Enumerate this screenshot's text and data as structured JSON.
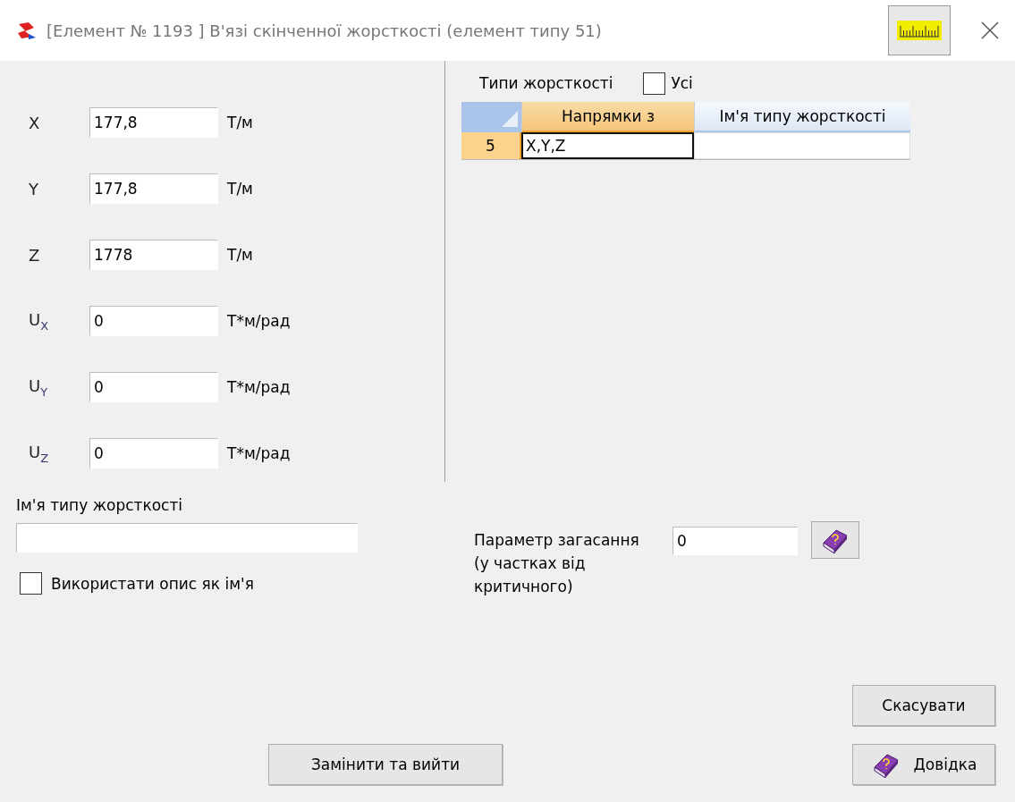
{
  "window": {
    "title": "[Елемент № 1193 ] В'язі скінченної жорсткості (елемент типу 51)"
  },
  "stiffness": [
    {
      "label": "X",
      "value": "177,8",
      "unit": "Т/м"
    },
    {
      "label": "Y",
      "value": "177,8",
      "unit": "Т/м"
    },
    {
      "label": "Z",
      "value": "1778",
      "unit": "Т/м"
    },
    {
      "label": "U$_{X}$",
      "value": "0",
      "unit": "Т*м/рад"
    },
    {
      "label": "U$_{Y}$",
      "value": "0",
      "unit": "Т*м/рад"
    },
    {
      "label": "U$_{Z}$",
      "value": "0",
      "unit": "Т*м/рад"
    }
  ],
  "types_panel": {
    "label": "Типи жорсткості",
    "all_checkbox": {
      "label": "Усі",
      "checked": false
    },
    "table": {
      "columns": [
        {
          "label": "Напрямки з",
          "selected": true
        },
        {
          "label": "Ім'я типу жорсткості",
          "selected": false
        }
      ],
      "rows": [
        {
          "number": "5",
          "selected": true,
          "directions": "X,Y,Z"
        }
      ]
    }
  },
  "name_field": {
    "label": "Ім'я типу жорсткості"
  },
  "use_description": {
    "label": "Використати опис як ім'я",
    "checked": false
  },
  "damping": {
    "label": "Параметр загасання",
    "note": "(у частках від критичного)",
    "value": "0"
  },
  "buttons": [
    {
      "label": "Скасувати",
      "kind": "cancel"
    },
    {
      "label": "Замінити та вийти",
      "kind": "replace"
    },
    {
      "label": "Довідка",
      "kind": "help"
    }
  ]
}
